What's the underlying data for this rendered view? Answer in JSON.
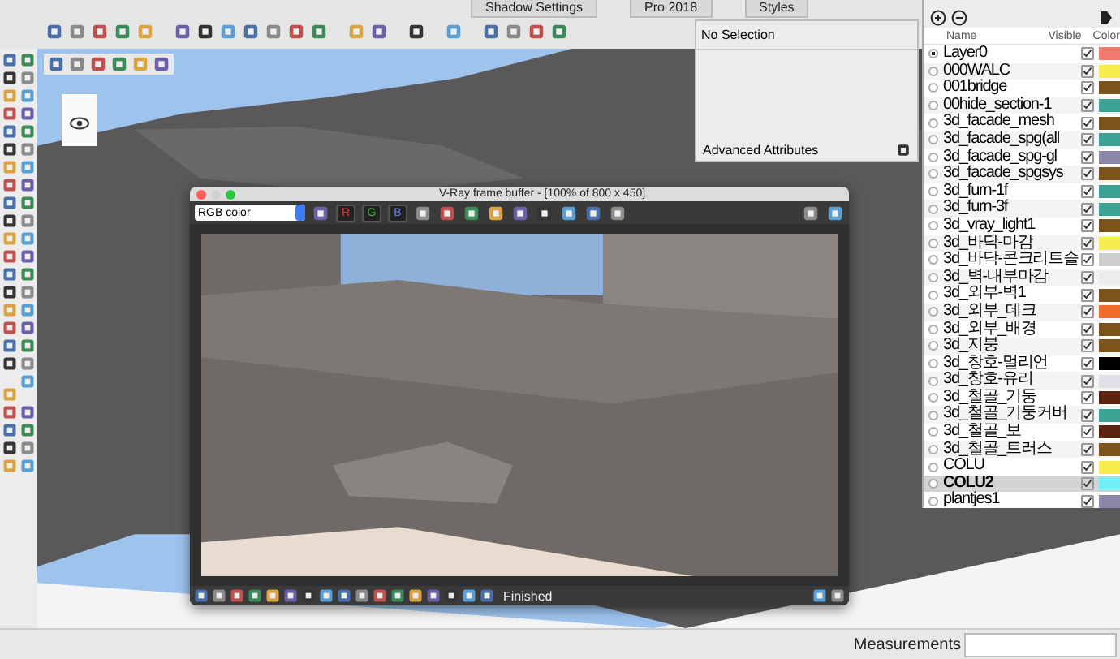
{
  "tray_tabs": [
    {
      "label": "Shadow Settings"
    },
    {
      "label": "Pro 2018"
    },
    {
      "label": "Styles"
    }
  ],
  "entity_info": {
    "selection": "No Selection",
    "advanced": "Advanced Attributes"
  },
  "layers": {
    "columns": [
      "Name",
      "Visible",
      "Color"
    ],
    "rows": [
      {
        "name": "Layer0",
        "current": true,
        "visible": true,
        "selected": false,
        "color": "#f07a6e"
      },
      {
        "name": "000WALC",
        "current": false,
        "visible": true,
        "selected": false,
        "color": "#f5ed4c"
      },
      {
        "name": "001bridge",
        "current": false,
        "visible": true,
        "selected": false,
        "color": "#7a5418"
      },
      {
        "name": "00hide_section-1",
        "current": false,
        "visible": true,
        "selected": false,
        "color": "#3aa396"
      },
      {
        "name": "3d_facade_mesh",
        "current": false,
        "visible": true,
        "selected": false,
        "color": "#7a5418"
      },
      {
        "name": "3d_facade_spg(all",
        "current": false,
        "visible": true,
        "selected": false,
        "color": "#3aa396"
      },
      {
        "name": "3d_facade_spg-gl",
        "current": false,
        "visible": true,
        "selected": false,
        "color": "#8a86a8"
      },
      {
        "name": "3d_facade_spgsys",
        "current": false,
        "visible": true,
        "selected": false,
        "color": "#7a5418"
      },
      {
        "name": "3d_furn-1f",
        "current": false,
        "visible": true,
        "selected": false,
        "color": "#3aa396"
      },
      {
        "name": "3d_furn-3f",
        "current": false,
        "visible": true,
        "selected": false,
        "color": "#3aa396"
      },
      {
        "name": "3d_vray_light1",
        "current": false,
        "visible": true,
        "selected": false,
        "color": "#7a5418"
      },
      {
        "name": "3d_바닥-마감",
        "current": false,
        "visible": true,
        "selected": false,
        "color": "#f5ed4c"
      },
      {
        "name": "3d_바닥-콘크리트슬",
        "current": false,
        "visible": true,
        "selected": false,
        "color": "#cfcfcf"
      },
      {
        "name": "3d_벽-내부마감",
        "current": false,
        "visible": true,
        "selected": false,
        "color": "#ececec"
      },
      {
        "name": "3d_외부-벽1",
        "current": false,
        "visible": true,
        "selected": false,
        "color": "#7a5418"
      },
      {
        "name": "3d_외부_데크",
        "current": false,
        "visible": true,
        "selected": false,
        "color": "#f06a2a"
      },
      {
        "name": "3d_외부_배경",
        "current": false,
        "visible": true,
        "selected": false,
        "color": "#7a5418"
      },
      {
        "name": "3d_지붕",
        "current": false,
        "visible": true,
        "selected": false,
        "color": "#7a5418"
      },
      {
        "name": "3d_창호-멀리언",
        "current": false,
        "visible": true,
        "selected": false,
        "color": "#000000"
      },
      {
        "name": "3d_창호-유리",
        "current": false,
        "visible": true,
        "selected": false,
        "color": "#e0e0e8"
      },
      {
        "name": "3d_철골_기둥",
        "current": false,
        "visible": true,
        "selected": false,
        "color": "#5c2410"
      },
      {
        "name": "3d_철골_기둥커버",
        "current": false,
        "visible": true,
        "selected": false,
        "color": "#3aa396"
      },
      {
        "name": "3d_철골_보",
        "current": false,
        "visible": true,
        "selected": false,
        "color": "#5c2410"
      },
      {
        "name": "3d_철골_트러스",
        "current": false,
        "visible": true,
        "selected": false,
        "color": "#7a5418"
      },
      {
        "name": "COLU",
        "current": false,
        "visible": true,
        "selected": false,
        "color": "#f5ed4c"
      },
      {
        "name": "COLU2",
        "current": false,
        "visible": true,
        "selected": true,
        "color": "#6ef0f5"
      },
      {
        "name": "plantjes1",
        "current": false,
        "visible": true,
        "selected": false,
        "color": "#8a86a8"
      }
    ]
  },
  "vray": {
    "title": "V-Ray frame buffer - [100% of 800 x 450]",
    "channel": "RGB color",
    "channel_buttons": [
      "R",
      "G",
      "B"
    ],
    "status": "Finished"
  },
  "status_bar": {
    "label": "Measurements"
  }
}
